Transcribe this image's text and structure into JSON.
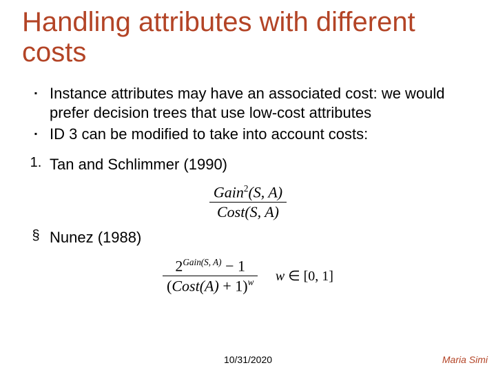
{
  "title": "Handling attributes with different costs",
  "bullets": {
    "b1": "Instance attributes may have an associated cost: we would prefer decision trees that use low-cost attributes",
    "b2": "ID 3 can be modified to take into account costs:"
  },
  "item1": {
    "marker": "1.",
    "text": "Tan and Schlimmer   (1990)"
  },
  "item2": {
    "marker": "§",
    "text": "Nunez (1988)"
  },
  "formula1": {
    "num_gain": "Gain",
    "num_exp": "2",
    "num_args": "(S, A)",
    "den_cost": "Cost",
    "den_args": "(S, A)"
  },
  "formula2": {
    "base": "2",
    "exp_gain": "Gain",
    "exp_args": "(S, A)",
    "minus": " − 1",
    "den_open": "(",
    "den_cost": "Cost",
    "den_arg": "(A)",
    "den_plus": " + 1)",
    "den_exp": "w",
    "side_w": "w",
    "side_in": " ∈ [0, 1]"
  },
  "footer": {
    "date": "10/31/2020",
    "author": "Maria Simi"
  }
}
